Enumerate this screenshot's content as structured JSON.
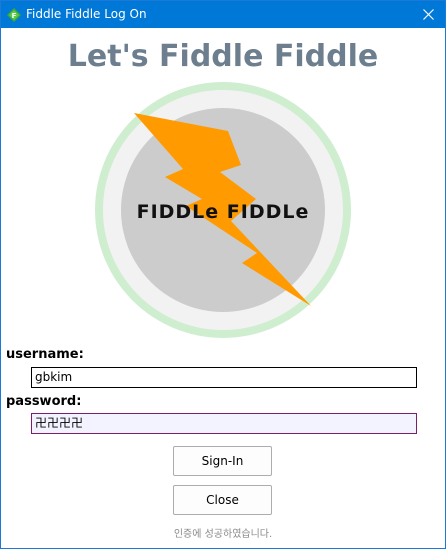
{
  "window": {
    "title": "Fiddle Fiddle Log On",
    "accent_color": "#0078d7",
    "icon": "fiddle-app-icon",
    "close_icon": "close-icon"
  },
  "heading": "Let's Fiddle Fiddle",
  "logo": {
    "text": "FIDDLe FIDDLe",
    "ring_color": "#cfeed0",
    "disc_color": "#cccccc",
    "bolt_color": "#ff9a00"
  },
  "form": {
    "username_label": "username:",
    "username_value": "gbkim",
    "password_label": "password:",
    "password_value": "卍卍卍卍"
  },
  "buttons": {
    "signin_label": "Sign-In",
    "close_label": "Close"
  },
  "status_text": "인증에 성공하였습니다."
}
